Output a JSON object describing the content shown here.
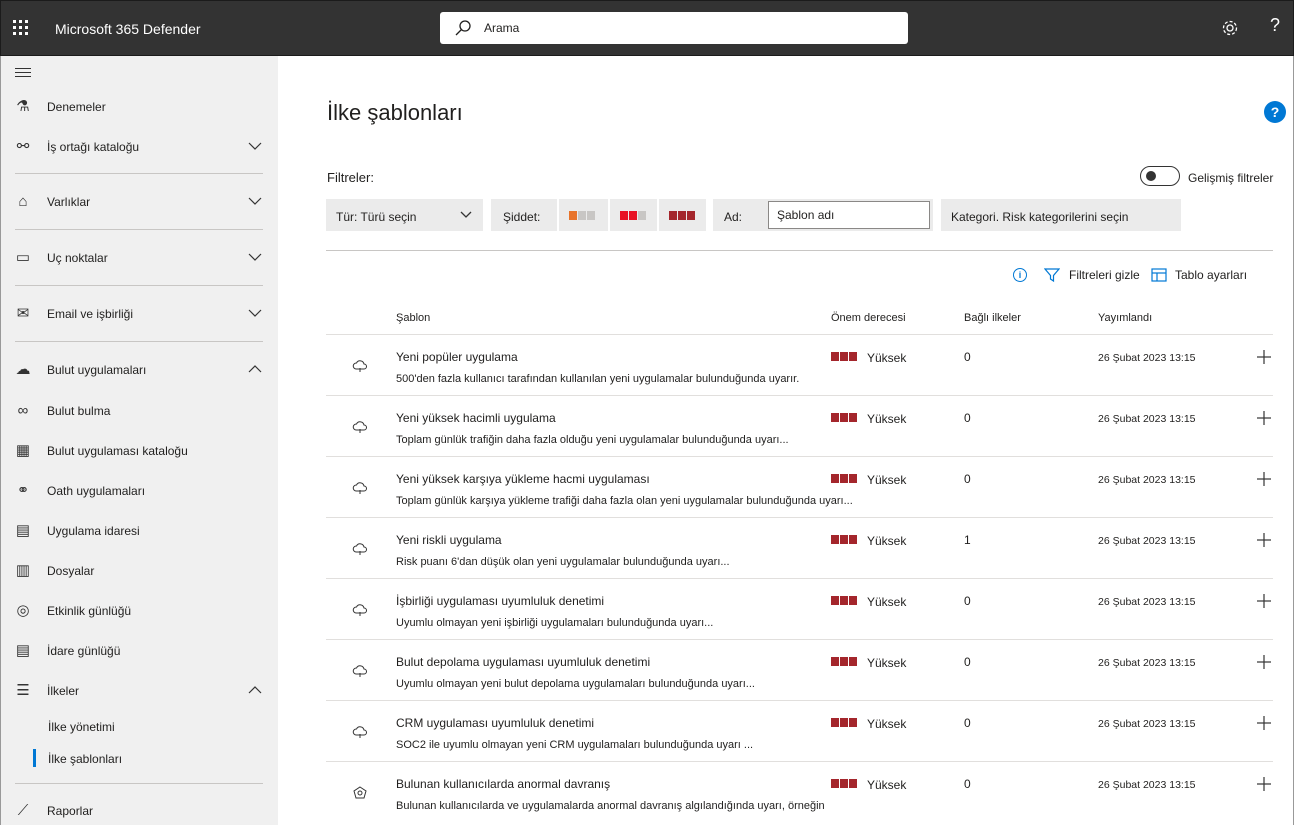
{
  "topbar": {
    "app_title": "Microsoft 365 Defender",
    "search_placeholder": "Arama",
    "help_label": "?"
  },
  "sidebar": {
    "items": [
      {
        "label": "Denemeler",
        "icon": "flask-icon"
      },
      {
        "label": "İş ortağı kataloğu",
        "icon": "partner-icon"
      },
      {
        "label": "Varlıklar",
        "icon": "assets-icon"
      },
      {
        "label": "Uç noktalar",
        "icon": "endpoints-icon"
      },
      {
        "label": "Email ve işbirliği",
        "icon": "mail-icon"
      },
      {
        "label": "Bulut uygulamaları",
        "icon": "cloud-icon"
      },
      {
        "label": "Bulut bulma",
        "icon": "binoculars-icon"
      },
      {
        "label": "Bulut uygulaması kataloğu",
        "icon": "catalog-icon"
      },
      {
        "label": "Oath uygulamaları",
        "icon": "oauth-icon"
      },
      {
        "label": "Uygulama idaresi",
        "icon": "clipboard-icon"
      },
      {
        "label": "Dosyalar",
        "icon": "file-icon"
      },
      {
        "label": "Etkinlik günlüğü",
        "icon": "glasses-icon"
      },
      {
        "label": "İdare günlüğü",
        "icon": "clipboard-list-icon"
      },
      {
        "label": "İlkeler",
        "icon": "sliders-icon"
      },
      {
        "label": "İlke yönetimi"
      },
      {
        "label": "İlke şablonları"
      },
      {
        "label": "Raporlar",
        "icon": "chart-icon"
      }
    ]
  },
  "main": {
    "page_title": "İlke şablonları",
    "help_label": "?",
    "filters_label": "Filtreler:",
    "advanced_filters_label": "Gelişmiş filtreler",
    "advanced_filters_on": false,
    "type_filter": "Tür: Türü seçin",
    "severity_label": "Şiddet:",
    "name_label": "Ad:",
    "name_value": "Şablon adı",
    "category_filter": "Kategori. Risk kategorilerini seçin",
    "hide_filters_label": "Filtreleri gizle",
    "table_settings_label": "Tablo ayarları",
    "info_label": "i",
    "severity_colors": {
      "low": "#e8732a",
      "medium": "#e81123",
      "high": "#a4262c",
      "empty": "#c8c6c4"
    },
    "columns": [
      "Şablon",
      "Önem derecesi",
      "Bağlı ilkeler",
      "Yayımlandı"
    ],
    "rows": [
      {
        "title": "Yeni popüler uygulama",
        "desc": "500'den fazla kullanıcı tarafından kullanılan yeni uygulamalar bulunduğunda uyarır.",
        "severity": "Yüksek",
        "linked": "0",
        "date": "26 Şubat 2023 13:15",
        "icon": "cloud-alert-icon"
      },
      {
        "title": "Yeni yüksek hacimli uygulama",
        "desc": "Toplam günlük trafiğin daha fazla olduğu yeni uygulamalar bulunduğunda uyarı...",
        "severity": "Yüksek",
        "linked": "0",
        "date": "26 Şubat 2023 13:15",
        "icon": "cloud-alert-icon"
      },
      {
        "title": "Yeni yüksek karşıya yükleme hacmi uygulaması",
        "desc": "Toplam günlük karşıya yükleme trafiği daha fazla olan yeni uygulamalar bulunduğunda uyarı...",
        "severity": "Yüksek",
        "linked": "0",
        "date": "26 Şubat 2023 13:15",
        "icon": "cloud-alert-icon"
      },
      {
        "title": "Yeni riskli uygulama",
        "desc": "Risk puanı 6'dan düşük olan yeni uygulamalar bulunduğunda uyarı...",
        "severity": "Yüksek",
        "linked": "1",
        "date": "26 Şubat 2023 13:15",
        "icon": "cloud-alert-icon"
      },
      {
        "title": "İşbirliği uygulaması uyumluluk denetimi",
        "desc": "Uyumlu olmayan yeni işbirliği uygulamaları bulunduğunda uyarı...",
        "severity": "Yüksek",
        "linked": "0",
        "date": "26 Şubat 2023 13:15",
        "icon": "cloud-alert-icon"
      },
      {
        "title": "Bulut depolama uygulaması uyumluluk denetimi",
        "desc": "Uyumlu olmayan yeni bulut depolama uygulamaları bulunduğunda uyarı...",
        "severity": "Yüksek",
        "linked": "0",
        "date": "26 Şubat 2023 13:15",
        "icon": "cloud-alert-icon"
      },
      {
        "title": "CRM uygulaması uyumluluk denetimi",
        "desc": "SOC2 ile uyumlu olmayan yeni CRM uygulamaları bulunduğunda uyarı ...",
        "severity": "Yüksek",
        "linked": "0",
        "date": "26 Şubat 2023 13:15",
        "icon": "cloud-alert-icon"
      },
      {
        "title": "Bulunan kullanıcılarda anormal davranış",
        "desc": "Bulunan kullanıcılarda ve uygulamalarda anormal davranış algılandığında uyarı, örneğin",
        "severity": "Yüksek",
        "linked": "0",
        "date": "26 Şubat 2023 13:15",
        "icon": "anomaly-icon"
      }
    ]
  }
}
